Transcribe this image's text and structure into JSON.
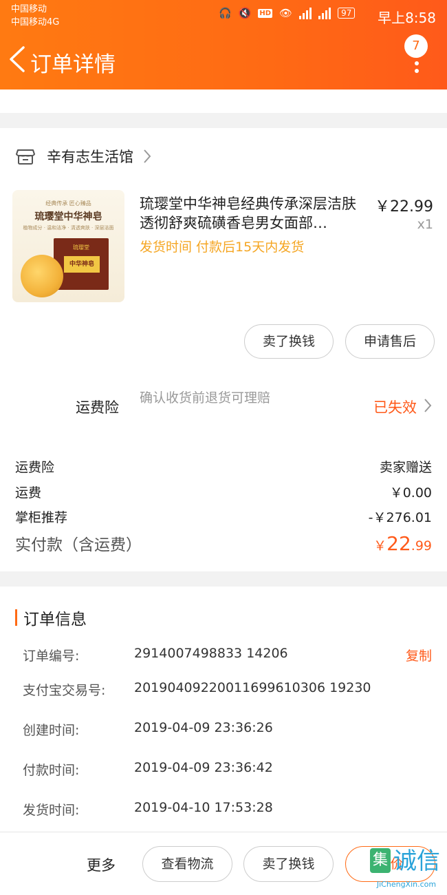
{
  "status_bar": {
    "carrier1": "中国移动",
    "carrier2": "中国移动4G",
    "hd": "HD",
    "battery": "97",
    "time": "早上8:58"
  },
  "header": {
    "title": "订单详情",
    "badge": "7"
  },
  "shop": {
    "name": "辛有志生活馆"
  },
  "product": {
    "thumb_text": {
      "top": "经典传承 匠心臻品",
      "brand": "琉璎堂中华神皂",
      "sub": "植物成分 · 温和洁净 · 清透爽肤 · 深层洁面",
      "box_brand": "琉璎堂",
      "box_label": "中华神皂"
    },
    "title": "琉璎堂中华神皂经典传承深层洁肤透彻舒爽硫磺香皂男女面部…",
    "price": "￥22.99",
    "qty": "x1",
    "ship_note": "发货时间 付款后15天内发货"
  },
  "actions": {
    "sell": "卖了换钱",
    "after_sale": "申请售后"
  },
  "insurance": {
    "label": "运费险",
    "desc": "确认收货前退货可理赔",
    "status": "已失效"
  },
  "fees": [
    {
      "label": "运费险",
      "value": "卖家赠送"
    },
    {
      "label": "运费",
      "value": "￥0.00"
    },
    {
      "label": "掌柜推荐",
      "value": "-￥276.01"
    }
  ],
  "total": {
    "label": "实付款（含运费）",
    "currency": "￥",
    "int": "22",
    "dec": ".99"
  },
  "order_info": {
    "title": "订单信息",
    "copy_label": "复制",
    "rows": [
      {
        "key": "订单编号:",
        "value": "2914007498833 14206"
      },
      {
        "key": "支付宝交易号:",
        "value": "20190409220011699610306 19230"
      },
      {
        "key": "创建时间:",
        "value": "2019-04-09 23:36:26"
      },
      {
        "key": "付款时间:",
        "value": "2019-04-09 23:36:42"
      },
      {
        "key": "发货时间:",
        "value": "2019-04-10 17:53:28"
      }
    ]
  },
  "bottom_bar": {
    "more": "更多",
    "logistics": "查看物流",
    "sell": "卖了换钱",
    "rate": "评价"
  },
  "watermark": {
    "logo": "集",
    "chars": "诚信",
    "url": "JiChengXin.com"
  },
  "colors": {
    "accent": "#ff6a14",
    "accent_text": "#ff5a1a",
    "ship_note": "#f5a623"
  }
}
